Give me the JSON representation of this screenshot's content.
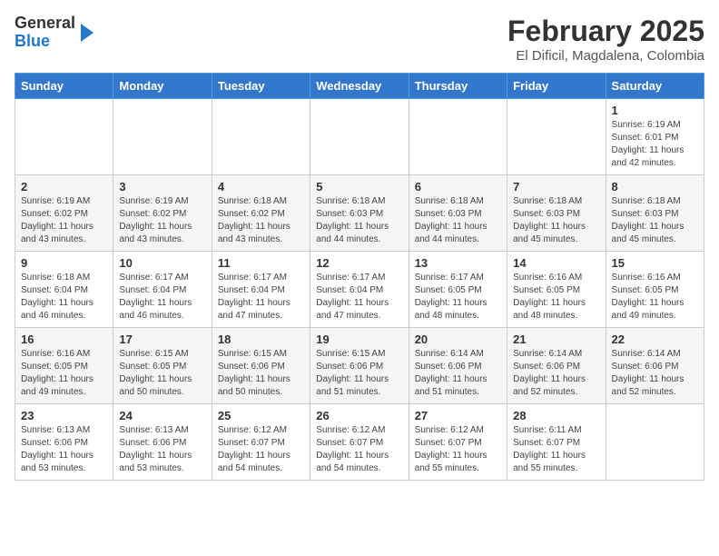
{
  "header": {
    "logo_general": "General",
    "logo_blue": "Blue",
    "title": "February 2025",
    "subtitle": "El Dificil, Magdalena, Colombia"
  },
  "weekdays": [
    "Sunday",
    "Monday",
    "Tuesday",
    "Wednesday",
    "Thursday",
    "Friday",
    "Saturday"
  ],
  "weeks": [
    [
      {
        "day": "",
        "info": ""
      },
      {
        "day": "",
        "info": ""
      },
      {
        "day": "",
        "info": ""
      },
      {
        "day": "",
        "info": ""
      },
      {
        "day": "",
        "info": ""
      },
      {
        "day": "",
        "info": ""
      },
      {
        "day": "1",
        "info": "Sunrise: 6:19 AM\nSunset: 6:01 PM\nDaylight: 11 hours and 42 minutes."
      }
    ],
    [
      {
        "day": "2",
        "info": "Sunrise: 6:19 AM\nSunset: 6:02 PM\nDaylight: 11 hours and 43 minutes."
      },
      {
        "day": "3",
        "info": "Sunrise: 6:19 AM\nSunset: 6:02 PM\nDaylight: 11 hours and 43 minutes."
      },
      {
        "day": "4",
        "info": "Sunrise: 6:18 AM\nSunset: 6:02 PM\nDaylight: 11 hours and 43 minutes."
      },
      {
        "day": "5",
        "info": "Sunrise: 6:18 AM\nSunset: 6:03 PM\nDaylight: 11 hours and 44 minutes."
      },
      {
        "day": "6",
        "info": "Sunrise: 6:18 AM\nSunset: 6:03 PM\nDaylight: 11 hours and 44 minutes."
      },
      {
        "day": "7",
        "info": "Sunrise: 6:18 AM\nSunset: 6:03 PM\nDaylight: 11 hours and 45 minutes."
      },
      {
        "day": "8",
        "info": "Sunrise: 6:18 AM\nSunset: 6:03 PM\nDaylight: 11 hours and 45 minutes."
      }
    ],
    [
      {
        "day": "9",
        "info": "Sunrise: 6:18 AM\nSunset: 6:04 PM\nDaylight: 11 hours and 46 minutes."
      },
      {
        "day": "10",
        "info": "Sunrise: 6:17 AM\nSunset: 6:04 PM\nDaylight: 11 hours and 46 minutes."
      },
      {
        "day": "11",
        "info": "Sunrise: 6:17 AM\nSunset: 6:04 PM\nDaylight: 11 hours and 47 minutes."
      },
      {
        "day": "12",
        "info": "Sunrise: 6:17 AM\nSunset: 6:04 PM\nDaylight: 11 hours and 47 minutes."
      },
      {
        "day": "13",
        "info": "Sunrise: 6:17 AM\nSunset: 6:05 PM\nDaylight: 11 hours and 48 minutes."
      },
      {
        "day": "14",
        "info": "Sunrise: 6:16 AM\nSunset: 6:05 PM\nDaylight: 11 hours and 48 minutes."
      },
      {
        "day": "15",
        "info": "Sunrise: 6:16 AM\nSunset: 6:05 PM\nDaylight: 11 hours and 49 minutes."
      }
    ],
    [
      {
        "day": "16",
        "info": "Sunrise: 6:16 AM\nSunset: 6:05 PM\nDaylight: 11 hours and 49 minutes."
      },
      {
        "day": "17",
        "info": "Sunrise: 6:15 AM\nSunset: 6:05 PM\nDaylight: 11 hours and 50 minutes."
      },
      {
        "day": "18",
        "info": "Sunrise: 6:15 AM\nSunset: 6:06 PM\nDaylight: 11 hours and 50 minutes."
      },
      {
        "day": "19",
        "info": "Sunrise: 6:15 AM\nSunset: 6:06 PM\nDaylight: 11 hours and 51 minutes."
      },
      {
        "day": "20",
        "info": "Sunrise: 6:14 AM\nSunset: 6:06 PM\nDaylight: 11 hours and 51 minutes."
      },
      {
        "day": "21",
        "info": "Sunrise: 6:14 AM\nSunset: 6:06 PM\nDaylight: 11 hours and 52 minutes."
      },
      {
        "day": "22",
        "info": "Sunrise: 6:14 AM\nSunset: 6:06 PM\nDaylight: 11 hours and 52 minutes."
      }
    ],
    [
      {
        "day": "23",
        "info": "Sunrise: 6:13 AM\nSunset: 6:06 PM\nDaylight: 11 hours and 53 minutes."
      },
      {
        "day": "24",
        "info": "Sunrise: 6:13 AM\nSunset: 6:06 PM\nDaylight: 11 hours and 53 minutes."
      },
      {
        "day": "25",
        "info": "Sunrise: 6:12 AM\nSunset: 6:07 PM\nDaylight: 11 hours and 54 minutes."
      },
      {
        "day": "26",
        "info": "Sunrise: 6:12 AM\nSunset: 6:07 PM\nDaylight: 11 hours and 54 minutes."
      },
      {
        "day": "27",
        "info": "Sunrise: 6:12 AM\nSunset: 6:07 PM\nDaylight: 11 hours and 55 minutes."
      },
      {
        "day": "28",
        "info": "Sunrise: 6:11 AM\nSunset: 6:07 PM\nDaylight: 11 hours and 55 minutes."
      },
      {
        "day": "",
        "info": ""
      }
    ]
  ]
}
